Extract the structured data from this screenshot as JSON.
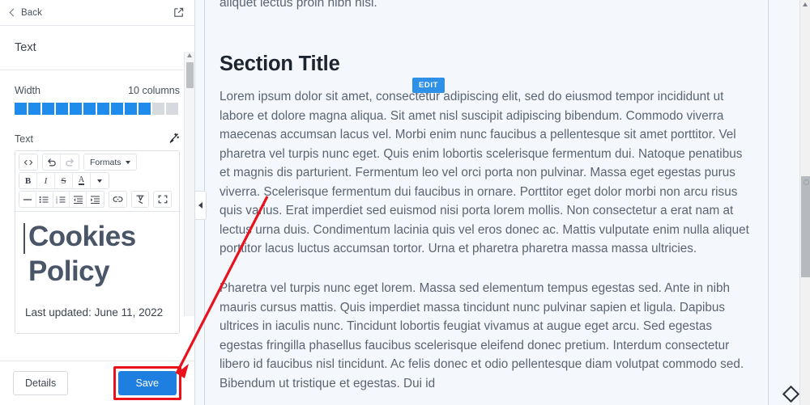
{
  "sidebar": {
    "back_label": "Back",
    "back_icon": "chevron-left-icon",
    "external_icon": "external-link-icon",
    "panel_title": "Text",
    "width": {
      "label": "Width",
      "value_label": "10 columns",
      "filled": 10,
      "total": 12,
      "fill_color": "#1f8ceb",
      "empty_color": "#d6d9dd"
    },
    "text_field": {
      "label": "Text",
      "wand_icon": "magic-wand-icon"
    },
    "toolbar": {
      "row1": [
        {
          "name": "source-code-button",
          "glyph": "<>"
        },
        {
          "name": "undo-button",
          "glyph": "undo"
        },
        {
          "name": "redo-button",
          "glyph": "redo"
        },
        {
          "name": "formats-dropdown",
          "glyph": "Formats"
        }
      ],
      "row2": [
        {
          "name": "bold-button",
          "glyph": "B"
        },
        {
          "name": "italic-button",
          "glyph": "I"
        },
        {
          "name": "strikethrough-button",
          "glyph": "S"
        },
        {
          "name": "text-color-button",
          "glyph": "A"
        }
      ],
      "row3": [
        {
          "name": "horizontal-rule-button",
          "glyph": "hr"
        },
        {
          "name": "bullet-list-button",
          "glyph": "ul"
        },
        {
          "name": "numbered-list-button",
          "glyph": "ol"
        },
        {
          "name": "outdent-button",
          "glyph": "outdent"
        },
        {
          "name": "indent-button",
          "glyph": "indent"
        },
        {
          "name": "link-button",
          "glyph": "link"
        },
        {
          "name": "clear-formatting-button",
          "glyph": "clear"
        },
        {
          "name": "fullscreen-button",
          "glyph": "fullscreen"
        }
      ],
      "formats_label": "Formats"
    },
    "editor": {
      "heading_line1": "Cookies",
      "heading_line2": "Policy",
      "last_updated": "Last updated: June 11, 2022"
    },
    "footer": {
      "details_label": "Details",
      "save_label": "Save",
      "save_highlight_color": "#e8111c"
    }
  },
  "collapse_handle": {
    "icon": "chevron-left-icon"
  },
  "main": {
    "clipped_top_line": "aliquet lectus proin nibh nisi.",
    "section_title": "Section Title",
    "edit_badge": "EDIT",
    "paragraph_1": "Lorem ipsum dolor sit amet, consectetur adipiscing elit, sed do eiusmod tempor incididunt ut labore et dolore magna aliqua. Sit amet nisl suscipit adipiscing bibendum. Commodo viverra maecenas accumsan lacus vel. Morbi enim nunc faucibus a pellentesque sit amet porttitor. Vel pharetra vel turpis nunc eget. Quis enim lobortis scelerisque fermentum dui. Natoque penatibus et magnis dis parturient. Fermentum leo vel orci porta non pulvinar. Massa eget egestas purus viverra. Scelerisque fermentum dui faucibus in ornare. Porttitor eget dolor morbi non arcu risus quis varius. Erat imperdiet sed euismod nisi porta lorem mollis. Non consectetur a erat nam at lectus urna duis. Condimentum lacinia quis vel eros donec ac. Mattis vulputate enim nulla aliquet porttitor lacus luctus accumsan tortor. Urna et pharetra pharetra massa massa ultricies.",
    "paragraph_2": "Pharetra vel turpis nunc eget lorem. Massa sed elementum tempus egestas sed. Ante in nibh mauris cursus mattis. Quis imperdiet massa tincidunt nunc pulvinar sapien et ligula. Dapibus ultrices in iaculis nunc. Tincidunt lobortis feugiat vivamus at augue eget arcu. Sed egestas egestas fringilla phasellus faucibus scelerisque eleifend donec pretium. Interdum consectetur libero id faucibus nisl tincidunt. Ac felis donec et odio pellentesque diam volutpat commodo sed. Bibendum ut tristique et egestas. Dui id"
  },
  "scrollbars": {
    "sidebar_scrollbar": "sidebar-scrollbar",
    "main_scrollbar": "main-scrollbar"
  },
  "resize_handle": {
    "icon": "resize-diamond-icon"
  },
  "annotation": {
    "arrow_color": "#e8111c",
    "arrow_name": "red-annotation-arrow"
  }
}
